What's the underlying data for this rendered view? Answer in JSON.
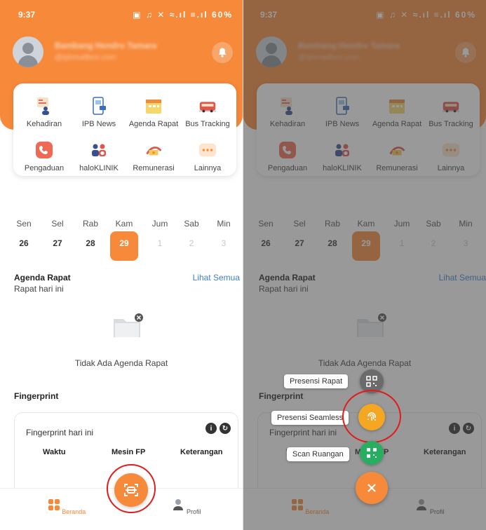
{
  "status_bar": {
    "time": "9:37",
    "icons": "▣ ♫ ✕ ≈.ıl ≡.ıl",
    "battery": "60%"
  },
  "profile": {
    "name": "Bambang Hendro Tamara",
    "email": "@ipbmailbox.com"
  },
  "menu_items": [
    {
      "label": "Kehadiran",
      "icon": "attendance-icon"
    },
    {
      "label": "IPB News",
      "icon": "news-icon"
    },
    {
      "label": "Agenda Rapat",
      "icon": "calendar-icon"
    },
    {
      "label": "Bus Tracking",
      "icon": "bus-icon"
    },
    {
      "label": "Pengaduan",
      "icon": "phone-icon"
    },
    {
      "label": "haloKLINIK",
      "icon": "clinic-icon"
    },
    {
      "label": "Remunerasi",
      "icon": "money-icon"
    },
    {
      "label": "Lainnya",
      "icon": "more-icon"
    }
  ],
  "week": [
    {
      "day": "Sen",
      "date": "26"
    },
    {
      "day": "Sel",
      "date": "27"
    },
    {
      "day": "Rab",
      "date": "28"
    },
    {
      "day": "Kam",
      "date": "29"
    },
    {
      "day": "Jum",
      "date": "1"
    },
    {
      "day": "Sab",
      "date": "2"
    },
    {
      "day": "Min",
      "date": "3"
    }
  ],
  "agenda": {
    "title": "Agenda Rapat",
    "subtitle": "Rapat hari ini",
    "see_all": "Lihat Semua",
    "empty": "Tidak Ada Agenda Rapat"
  },
  "fingerprint": {
    "title": "Fingerprint",
    "card_title": "Fingerprint hari ini",
    "columns": [
      "Waktu",
      "Mesin FP",
      "Keterangan"
    ]
  },
  "nav": {
    "home": "Beranda",
    "profile": "Profil"
  },
  "fab_menu": [
    {
      "label": "Presensi Rapat",
      "icon": "qr-icon"
    },
    {
      "label": "Presensi Seamless",
      "icon": "fingerprint-icon"
    },
    {
      "label": "Scan Ruangan",
      "icon": "scan-room-icon"
    }
  ],
  "colors": {
    "primary": "#f7893a",
    "link": "#3f7fcf",
    "highlight_ring": "#e21b1b"
  }
}
